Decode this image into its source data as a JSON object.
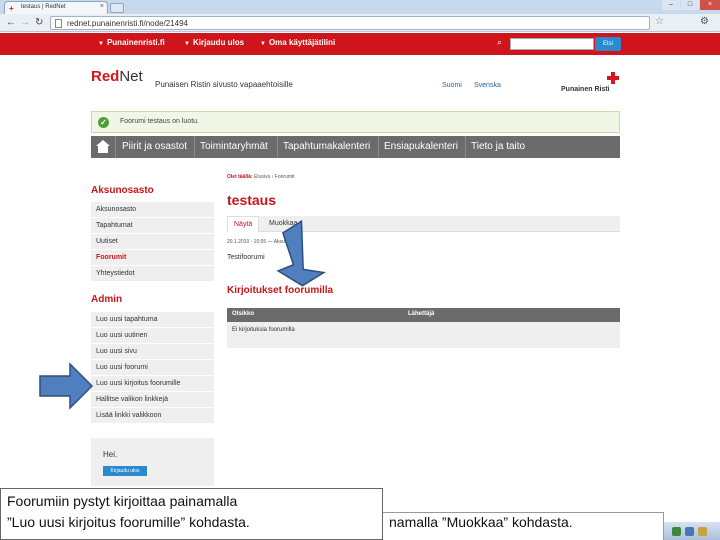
{
  "browser": {
    "tab_title": "testaus | RedNet",
    "url": "rednet.punainenristi.fi/node/21494"
  },
  "site_bar": {
    "items": [
      "Punainenristi.fi",
      "Kirjaudu ulos",
      "Oma käyttäjätilini"
    ],
    "search_button": "Etsi"
  },
  "header": {
    "logo_red": "Red",
    "logo_dark": "Net",
    "tagline": "Punaisen Ristin sivusto vapaaehtoisille",
    "links": [
      "Suomi",
      "Svenska"
    ],
    "brand": "Punainen Risti"
  },
  "status": {
    "message": "Foorumi testaus on luotu."
  },
  "main_nav": {
    "items": [
      "Piirit ja osastot",
      "Toimintaryhmät",
      "Tapahtumakalenteri",
      "Ensiapukalenteri",
      "Tieto ja taito"
    ]
  },
  "sidebar": {
    "section1_title": "Aksunosasto",
    "section1_items": [
      "Aksunosasto",
      "Tapahtumat",
      "Uutiset",
      "Foorumit",
      "Yhteystiedot"
    ],
    "section2_title": "Admin",
    "section2_items": [
      "Luo uusi tapahtuma",
      "Luo uusi uutinen",
      "Luo uusi sivu",
      "Luo uusi foorumi",
      "Luo uusi kirjoitus foorumille",
      "Hallitse valikon linkkejä",
      "Lisää linkki valikkoon"
    ],
    "greeting": "Hei.",
    "login_button": "Kirjaudu ulos"
  },
  "content": {
    "breadcrumb_first": "Olet täällä:",
    "breadcrumb_rest": "Etusivu › Foorumit",
    "title": "testaus",
    "tabs": [
      "Näytä",
      "Muokkaa"
    ],
    "meta": "20.1.2010 - 10:55 — Aksunosasto",
    "body_text": "Testifoorumi",
    "section_title": "Kirjoitukset foorumilla",
    "table_headers": [
      "Otsikko",
      "Lähettäjä"
    ],
    "table_empty": "Ei kirjoituksia foorumilla"
  },
  "annotations": {
    "left_line1": "Foorumiin pystyt kirjoittaa painamalla",
    "left_line2": "”Luo uusi kirjoitus foorumille” kohdasta.",
    "right_text": "namalla ”Muokkaa” kohdasta."
  },
  "colors": {
    "brand_red": "#cf141b",
    "nav_gray": "#6b6b6b",
    "arrow_blue": "#4f7fbf"
  }
}
